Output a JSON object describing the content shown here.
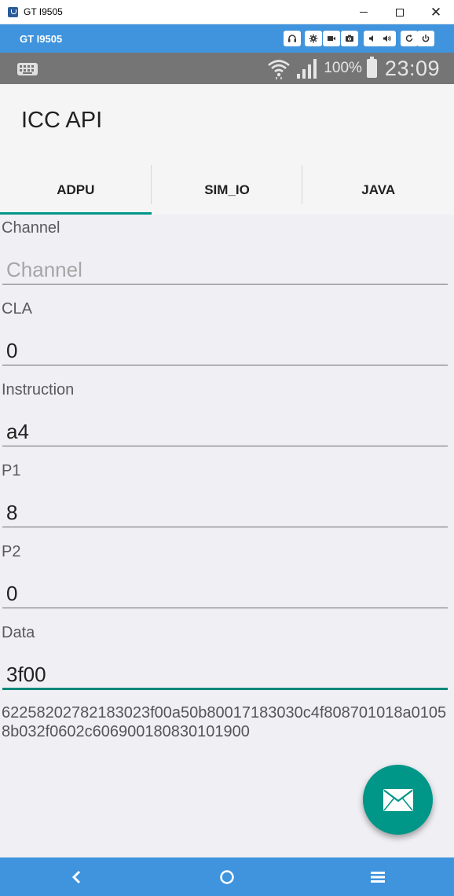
{
  "window": {
    "title": "GT I9505",
    "minimize_icon": "minimize-icon",
    "maximize_icon": "maximize-icon",
    "close_glyph": "✕"
  },
  "emulator": {
    "title": "GT I9505",
    "buttons": [
      "headphones-icon",
      "settings-icon",
      "video-camera-icon",
      "camera-icon",
      "volume-down-icon",
      "volume-up-icon",
      "rotate-icon",
      "power-icon"
    ]
  },
  "status_bar": {
    "battery": "100%",
    "time": "23:09"
  },
  "app": {
    "title": "ICC API"
  },
  "tabs": [
    {
      "label": "ADPU",
      "active": true
    },
    {
      "label": "SIM_IO",
      "active": false
    },
    {
      "label": "JAVA",
      "active": false
    }
  ],
  "form": {
    "channel": {
      "label": "Channel",
      "value": "",
      "placeholder": "Channel"
    },
    "cla": {
      "label": "CLA",
      "value": "0"
    },
    "instruction": {
      "label": "Instruction",
      "value": "a4"
    },
    "p1": {
      "label": "P1",
      "value": "8"
    },
    "p2": {
      "label": "P2",
      "value": "0"
    },
    "data": {
      "label": "Data",
      "value": "3f00"
    }
  },
  "response": "62258202782183023f00a50b80017183030c4f808701018a01058b032f0602c606900180830101900",
  "colors": {
    "accent": "#009688",
    "emulator_bar": "#3f94dd",
    "status_bar": "#757575",
    "content_bg": "#efeff4"
  }
}
